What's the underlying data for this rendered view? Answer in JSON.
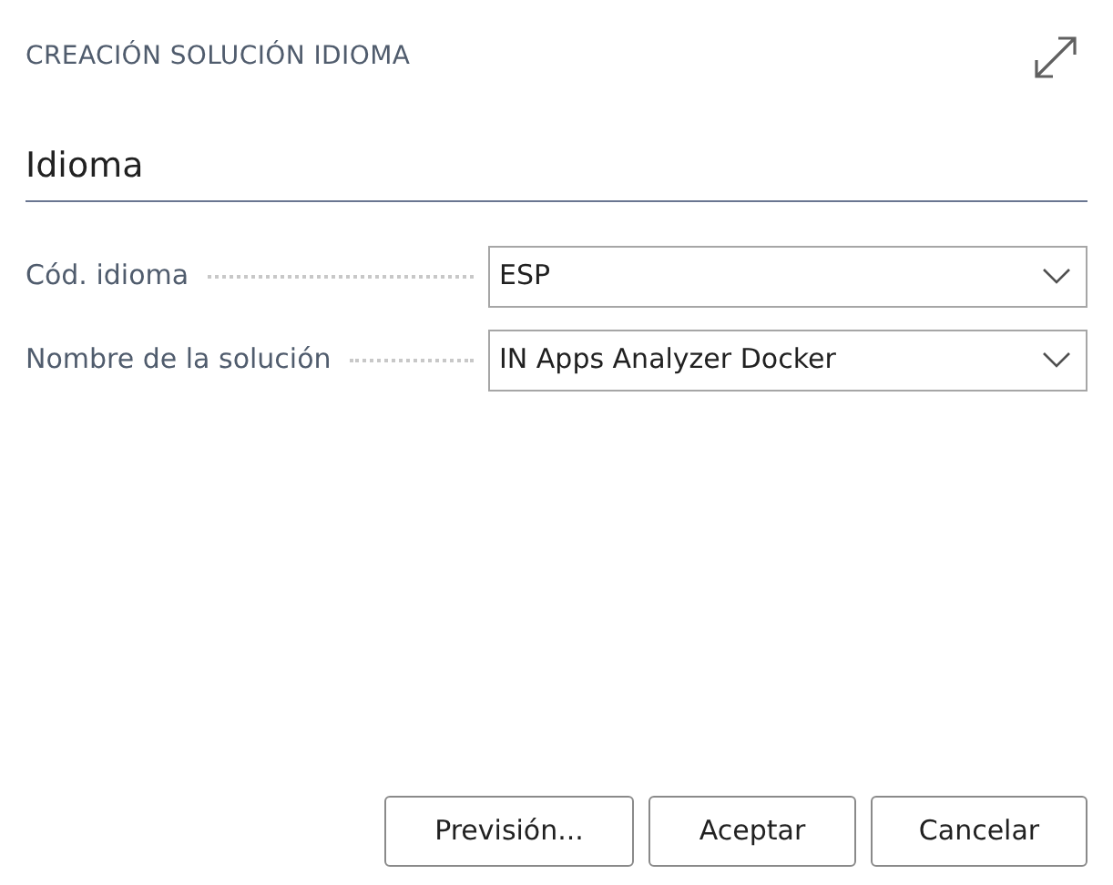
{
  "dialog": {
    "title": "CREACIÓN SOLUCIÓN IDIOMA"
  },
  "section": {
    "title": "Idioma"
  },
  "fields": [
    {
      "label": "Cód. idioma",
      "value": "ESP"
    },
    {
      "label": "Nombre de la solución",
      "value": "IN Apps Analyzer Docker"
    }
  ],
  "buttons": [
    "Previsión...",
    "Aceptar",
    "Cancelar"
  ]
}
